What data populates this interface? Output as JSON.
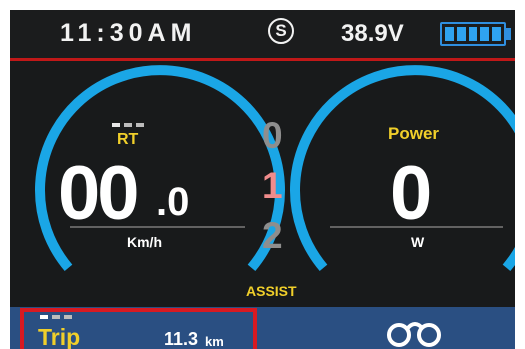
{
  "header": {
    "time": "11:30AM",
    "s_mark": "S",
    "voltage": "38.9V",
    "battery_level": 1.0
  },
  "speed_gauge": {
    "label": "RT",
    "integer": "00",
    "decimal": ".0",
    "unit": "Km/h"
  },
  "power_gauge": {
    "label": "Power",
    "value": "0",
    "unit": "W"
  },
  "assist": {
    "levels": [
      "0",
      "1",
      "2"
    ],
    "active": "1",
    "label": "ASSIST"
  },
  "trip": {
    "label": "Trip",
    "value": "11.3",
    "unit": "km"
  },
  "colors": {
    "accent_blue": "#1aa6e6",
    "label_yellow": "#f0cf2a",
    "active_level": "#f08c8c",
    "header_rule": "#c01818",
    "bottom_bar": "#2a4f82"
  }
}
